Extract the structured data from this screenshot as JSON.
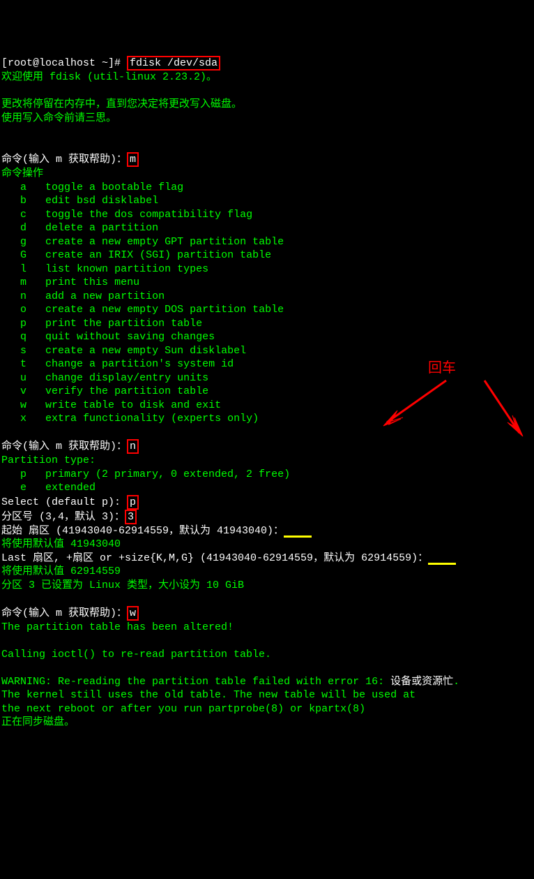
{
  "prompt": {
    "user_host": "[root@localhost ~]# ",
    "command": "fdisk /dev/sda"
  },
  "welcome": "欢迎使用 fdisk (util-linux 2.23.2)。",
  "notice1": "更改将停留在内存中，直到您决定将更改写入磁盘。",
  "notice2": "使用写入命令前请三思。",
  "cmd_prompt": "命令(输入 m 获取帮助)：",
  "input_m": "m",
  "menu_header": "命令操作",
  "menu": [
    {
      "key": "a",
      "desc": "toggle a bootable flag"
    },
    {
      "key": "b",
      "desc": "edit bsd disklabel"
    },
    {
      "key": "c",
      "desc": "toggle the dos compatibility flag"
    },
    {
      "key": "d",
      "desc": "delete a partition"
    },
    {
      "key": "g",
      "desc": "create a new empty GPT partition table"
    },
    {
      "key": "G",
      "desc": "create an IRIX (SGI) partition table"
    },
    {
      "key": "l",
      "desc": "list known partition types"
    },
    {
      "key": "m",
      "desc": "print this menu"
    },
    {
      "key": "n",
      "desc": "add a new partition"
    },
    {
      "key": "o",
      "desc": "create a new empty DOS partition table"
    },
    {
      "key": "p",
      "desc": "print the partition table"
    },
    {
      "key": "q",
      "desc": "quit without saving changes"
    },
    {
      "key": "s",
      "desc": "create a new empty Sun disklabel"
    },
    {
      "key": "t",
      "desc": "change a partition's system id"
    },
    {
      "key": "u",
      "desc": "change display/entry units"
    },
    {
      "key": "v",
      "desc": "verify the partition table"
    },
    {
      "key": "w",
      "desc": "write table to disk and exit"
    },
    {
      "key": "x",
      "desc": "extra functionality (experts only)"
    }
  ],
  "input_n": "n",
  "ptype_header": "Partition type:",
  "ptype_p": "   p   primary (2 primary, 0 extended, 2 free)",
  "ptype_e": "   e   extended",
  "select_prompt": "Select (default p): ",
  "input_p": "p",
  "partnum_prompt": "分区号 (3,4，默认 3)：",
  "input_3": "3",
  "start_sector": "起始 扇区 (41943040-62914559，默认为 41943040)：",
  "start_default": "将使用默认值 41943040",
  "last_sector": "Last 扇区, +扇区 or +size{K,M,G} (41943040-62914559，默认为 62914559)：",
  "last_default": "将使用默认值 62914559",
  "partition_set": "分区 3 已设置为 Linux 类型，大小设为 10 GiB",
  "input_w": "w",
  "altered": "The partition table has been altered!",
  "ioctl": "Calling ioctl() to re-read partition table.",
  "warning_line1_a": "WARNING: Re-reading the partition table failed with error 16: ",
  "warning_line1_b": "设备或资源忙",
  "warning_line1_c": ".",
  "warning_line2": "The kernel still uses the old table. The new table will be used at",
  "warning_line3": "the next reboot or after you run partprobe(8) or kpartx(8)",
  "syncing": "正在同步磁盘。",
  "annotation_enter": "回车"
}
